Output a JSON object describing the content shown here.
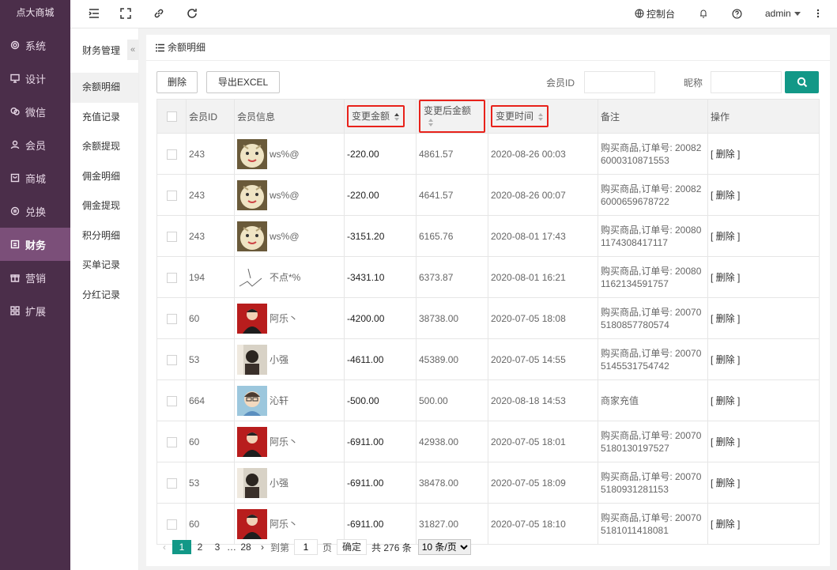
{
  "brand": "点大商城",
  "sidebar": {
    "items": [
      {
        "label": "系统",
        "icon": "gear-icon"
      },
      {
        "label": "设计",
        "icon": "monitor-icon"
      },
      {
        "label": "微信",
        "icon": "wechat-icon"
      },
      {
        "label": "会员",
        "icon": "user-icon"
      },
      {
        "label": "商城",
        "icon": "shop-icon"
      },
      {
        "label": "兑换",
        "icon": "exchange-icon"
      },
      {
        "label": "财务",
        "icon": "finance-icon",
        "active": true
      },
      {
        "label": "营销",
        "icon": "marketing-icon"
      },
      {
        "label": "扩展",
        "icon": "grid-icon"
      }
    ]
  },
  "header": {
    "console_label": "控制台",
    "user": "admin",
    "icons": [
      "menu-indent-icon",
      "fullscreen-icon",
      "link-icon",
      "refresh-icon",
      "globe-icon",
      "bell-icon",
      "help-icon",
      "more-icon"
    ]
  },
  "submenu": {
    "title": "财务管理",
    "collapse": "«",
    "items": [
      "余额明细",
      "充值记录",
      "余额提现",
      "佣金明细",
      "佣金提现",
      "积分明细",
      "买单记录",
      "分红记录"
    ]
  },
  "breadcrumb": "余额明细",
  "toolbar": {
    "delete_label": "删除",
    "export_label": "导出EXCEL"
  },
  "filters": {
    "member_id_label": "会员ID",
    "member_id_value": "",
    "nickname_label": "昵称",
    "nickname_value": ""
  },
  "table": {
    "headers": [
      "会员ID",
      "会员信息",
      "变更金额",
      "变更后金额",
      "变更时间",
      "备注",
      "操作"
    ],
    "rows": [
      {
        "id": "243",
        "name": "ws%@",
        "avatar": "bun",
        "amount": "-220.00",
        "after": "4861.57",
        "time": "2020-08-26 00:03",
        "remark": "购买商品,订单号: 200826000310871553",
        "op": "[ 删除 ]"
      },
      {
        "id": "243",
        "name": "ws%@",
        "avatar": "bun",
        "amount": "-220.00",
        "after": "4641.57",
        "time": "2020-08-26 00:07",
        "remark": "购买商品,订单号: 200826000659678722",
        "op": "[ 删除 ]"
      },
      {
        "id": "243",
        "name": "ws%@",
        "avatar": "bun",
        "amount": "-3151.20",
        "after": "6165.76",
        "time": "2020-08-01 17:43",
        "remark": "购买商品,订单号: 200801174308417117",
        "op": "[ 删除 ]"
      },
      {
        "id": "194",
        "name": "不点*%",
        "avatar": "sketch",
        "amount": "-3431.10",
        "after": "6373.87",
        "time": "2020-08-01 16:21",
        "remark": "购买商品,订单号: 200801162134591757",
        "op": "[ 删除 ]"
      },
      {
        "id": "60",
        "name": "阿乐丶",
        "avatar": "red",
        "amount": "-4200.00",
        "after": "38738.00",
        "time": "2020-07-05 18:08",
        "remark": "购买商品,订单号: 200705180857780574",
        "op": "[ 删除 ]"
      },
      {
        "id": "53",
        "name": "小强",
        "avatar": "photo",
        "amount": "-4611.00",
        "after": "45389.00",
        "time": "2020-07-05 14:55",
        "remark": "购买商品,订单号: 200705145531754742",
        "op": "[ 删除 ]"
      },
      {
        "id": "664",
        "name": "沁轩",
        "avatar": "blue",
        "amount": "-500.00",
        "after": "500.00",
        "time": "2020-08-18 14:53",
        "remark": "商家充值",
        "op": "[ 删除 ]"
      },
      {
        "id": "60",
        "name": "阿乐丶",
        "avatar": "red",
        "amount": "-6911.00",
        "after": "42938.00",
        "time": "2020-07-05 18:01",
        "remark": "购买商品,订单号: 200705180130197527",
        "op": "[ 删除 ]"
      },
      {
        "id": "53",
        "name": "小强",
        "avatar": "photo",
        "amount": "-6911.00",
        "after": "38478.00",
        "time": "2020-07-05 18:09",
        "remark": "购买商品,订单号: 200705180931281153",
        "op": "[ 删除 ]"
      },
      {
        "id": "60",
        "name": "阿乐丶",
        "avatar": "red",
        "amount": "-6911.00",
        "after": "31827.00",
        "time": "2020-07-05 18:10",
        "remark": "购买商品,订单号: 200705181011418081",
        "op": "[ 删除 ]"
      }
    ]
  },
  "pagination": {
    "pages": [
      "1",
      "2",
      "3",
      "…",
      "28"
    ],
    "current": "1",
    "goto_prefix": "到第",
    "goto_value": "1",
    "goto_suffix": "页",
    "confirm": "确定",
    "total": "共 276 条",
    "page_size": "10 条/页"
  },
  "colors": {
    "sidebar": "#4b2e4a",
    "sidebar_active": "#7b4f79",
    "accent": "#129887",
    "highlight_border": "#e8221b"
  }
}
